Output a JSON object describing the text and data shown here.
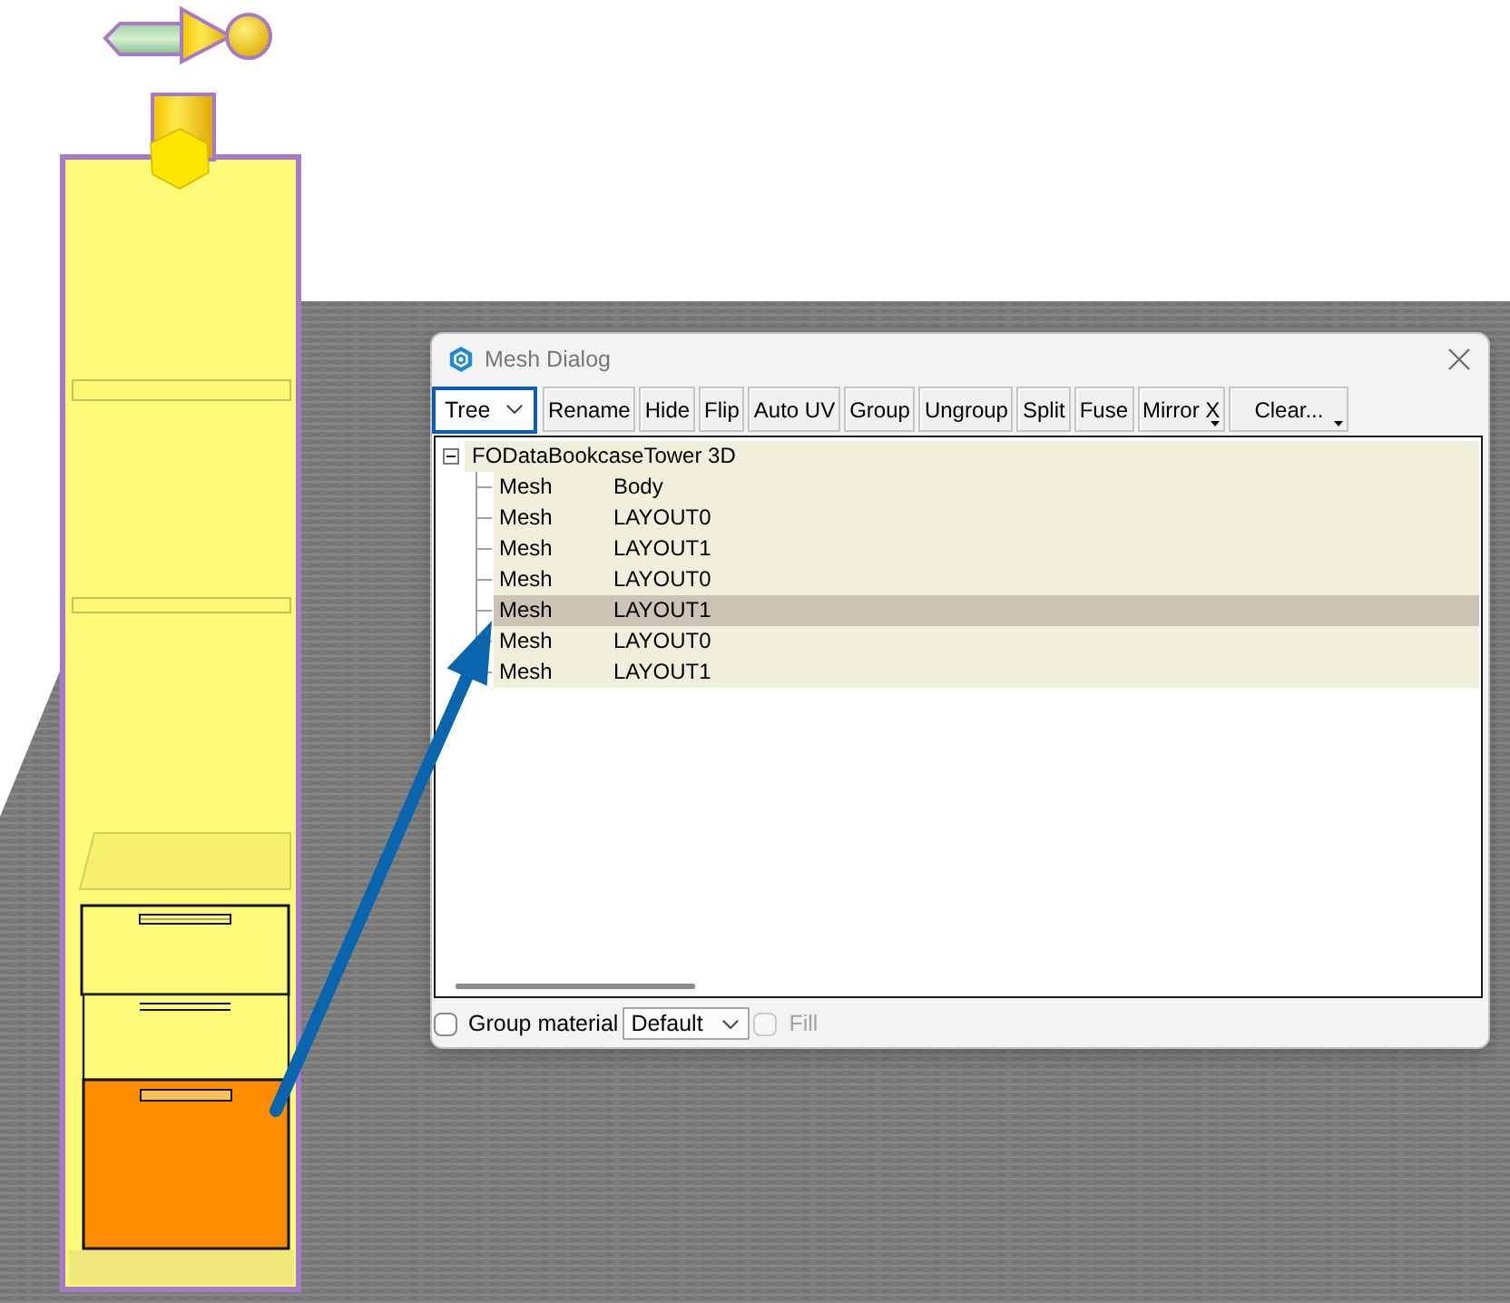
{
  "dialog": {
    "title": "Mesh Dialog"
  },
  "toolbar": {
    "view_select": {
      "value": "Tree",
      "focused": true
    },
    "buttons": [
      {
        "label": "Rename",
        "has_menu": false
      },
      {
        "label": "Hide",
        "has_menu": false
      },
      {
        "label": "Flip",
        "has_menu": false
      },
      {
        "label": "Auto UV",
        "has_menu": false
      },
      {
        "label": "Group",
        "has_menu": false
      },
      {
        "label": "Ungroup",
        "has_menu": false
      },
      {
        "label": "Split",
        "has_menu": false
      },
      {
        "label": "Fuse",
        "has_menu": false
      },
      {
        "label": "Mirror X",
        "has_menu": true
      },
      {
        "label": "Clear...",
        "has_menu": true
      }
    ]
  },
  "tree": {
    "root": {
      "label": "FODataBookcaseTower 3D",
      "expanded": true,
      "selected": false,
      "children": [
        {
          "column_1": "Mesh",
          "column_2": "Body",
          "selected": false
        },
        {
          "column_1": "Mesh",
          "column_2": "LAYOUT0",
          "selected": false
        },
        {
          "column_1": "Mesh",
          "column_2": "LAYOUT1",
          "selected": false
        },
        {
          "column_1": "Mesh",
          "column_2": "LAYOUT0",
          "selected": false
        },
        {
          "column_1": "Mesh",
          "column_2": "LAYOUT1",
          "selected": true
        },
        {
          "column_1": "Mesh",
          "column_2": "LAYOUT0",
          "selected": false
        },
        {
          "column_1": "Mesh",
          "column_2": "LAYOUT1",
          "selected": false
        }
      ]
    }
  },
  "footer": {
    "group_material": {
      "label": "Group material",
      "checked": false
    },
    "material_select": {
      "value": "Default"
    },
    "fill": {
      "label": "Fill",
      "checked": false,
      "disabled": true
    }
  }
}
